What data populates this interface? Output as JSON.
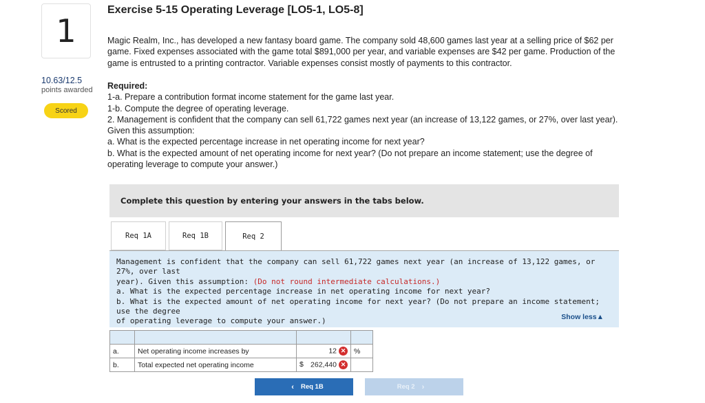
{
  "question": {
    "number": "1",
    "score": "10.63/12.5",
    "points_label": "points awarded",
    "status_badge": "Scored"
  },
  "exercise": {
    "title": "Exercise 5-15 Operating Leverage [LO5-1, LO5-8]",
    "intro": [
      "Magic Realm, Inc., has developed a new fantasy board game. The company sold 48,600 games last year at a selling price of $62 per",
      "game. Fixed expenses associated with the game total $891,000 per year, and variable expenses are $42 per game. Production of the",
      "game is entrusted to a printing contractor. Variable expenses consist mostly of payments to this contractor."
    ],
    "required_heading": "Required:",
    "required_lines": [
      "1-a. Prepare a contribution format income statement for the game last year.",
      "1-b. Compute the degree of operating leverage.",
      "2. Management is confident that the company can sell 61,722 games next year (an increase of 13,122 games, or 27%, over last year).",
      "Given this assumption:",
      "a. What is the expected percentage increase in net operating income for next year?",
      "b. What is the expected amount of net operating income for next year? (Do not prepare an income statement; use the degree of",
      "operating leverage to compute your answer.)"
    ]
  },
  "instructions": "Complete this question by entering your answers in the tabs below.",
  "tabs": [
    {
      "label": "Req 1A"
    },
    {
      "label": "Req 1B"
    },
    {
      "label": "Req 2"
    }
  ],
  "info_panel": {
    "line1": "Management is confident that the company can sell 61,722 games next year (an increase of 13,122 games, or 27%, over last",
    "line2_start": "year). Given this assumption: ",
    "line2_red": "(Do not round intermediate calculations.)",
    "line3": "a. What is the expected percentage increase in net operating income for next year?",
    "line4": "b. What is the expected amount of net operating income for next year? (Do not prepare an income statement; use the degree",
    "line5": "of operating leverage to compute your answer.)",
    "show_less": "Show less▲"
  },
  "answers": [
    {
      "letter": "a.",
      "label": "Net operating income increases by",
      "prefix": "",
      "value": "12",
      "unit": "%"
    },
    {
      "letter": "b.",
      "label": "Total expected net operating income",
      "prefix": "$",
      "value": "262,440",
      "unit": ""
    }
  ],
  "nav": {
    "prev_label": "Req 1B",
    "next_label": "Req 2"
  }
}
